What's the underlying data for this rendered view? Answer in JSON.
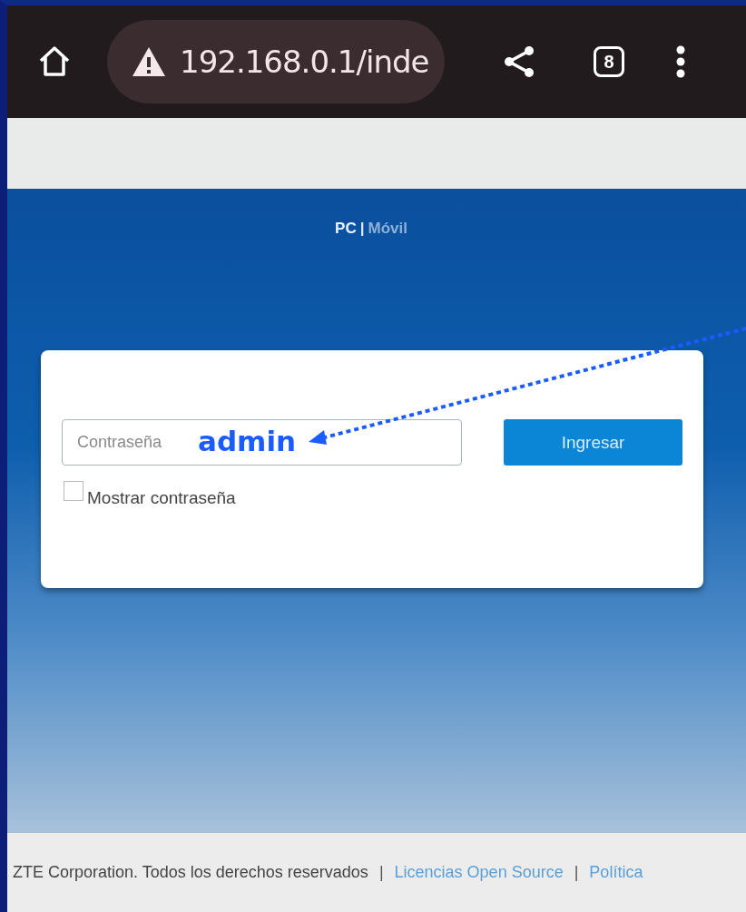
{
  "browser": {
    "url": "192.168.0.1/inde",
    "tab_count": "8"
  },
  "view_switch": [
    {
      "label": "PC",
      "selected": true
    },
    {
      "label": "Móvil",
      "selected": false
    }
  ],
  "separator": "|",
  "login": {
    "password_placeholder": "Contraseña",
    "show_password": {
      "label": "Mostrar contraseña",
      "checked": false
    },
    "submit": "Ingresar"
  },
  "annotation": {
    "label": "admin"
  },
  "footer": {
    "copyright": "ZTE Corporation. Todos los derechos reservados",
    "links": [
      "Licencias Open Source",
      "Política"
    ],
    "separator": "|"
  }
}
